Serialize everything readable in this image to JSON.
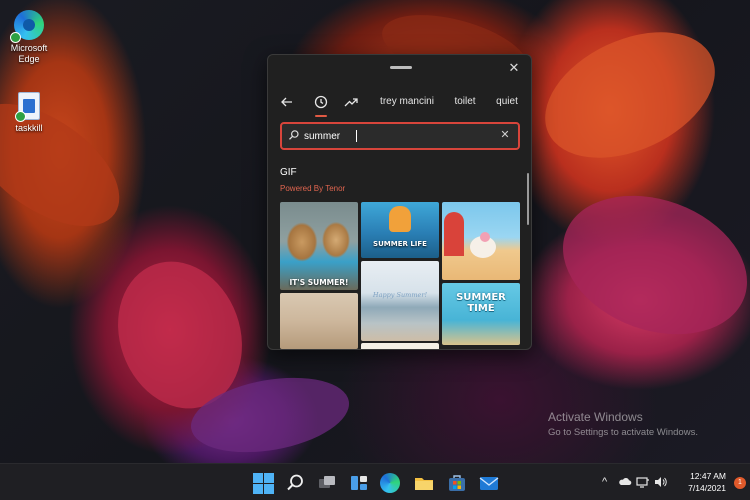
{
  "desktop": {
    "icons": [
      {
        "label_line1": "Microsoft",
        "label_line2": "Edge",
        "icon": "edge-icon"
      },
      {
        "label_line1": "taskkill",
        "label_line2": "",
        "icon": "file-icon"
      }
    ]
  },
  "emoji_panel": {
    "tabs": [
      {
        "label": "",
        "icon": "back-arrow-icon"
      },
      {
        "label": "",
        "icon": "recent-clock-icon",
        "active": true
      },
      {
        "label": "",
        "icon": "trending-arrow-icon"
      },
      {
        "label": "trey mancini"
      },
      {
        "label": "toilet"
      },
      {
        "label": "quiet"
      }
    ],
    "search": {
      "value": "summer",
      "placeholder": ""
    },
    "section_title": "GIF",
    "powered_by": "Powered By Tenor",
    "gifs": [
      {
        "caption": "IT'S SUMMER!"
      },
      {
        "caption": "SUMMER LIFE"
      },
      {
        "caption": ""
      },
      {
        "caption": "Happy Summer!"
      },
      {
        "caption": "SUMMER TIME"
      },
      {
        "caption": ""
      },
      {
        "caption": ""
      }
    ],
    "accent_color": "#e15a44"
  },
  "watermark": {
    "line1": "Activate Windows",
    "line2": "Go to Settings to activate Windows."
  },
  "taskbar": {
    "apps": [
      "start-icon",
      "search-icon",
      "task-view-icon",
      "widgets-icon",
      "edge-icon",
      "file-explorer-icon",
      "store-icon",
      "mail-icon"
    ],
    "tray": {
      "chevron": "^",
      "time": "12:47 AM",
      "date": "7/14/2021",
      "notification_count": "1"
    }
  }
}
